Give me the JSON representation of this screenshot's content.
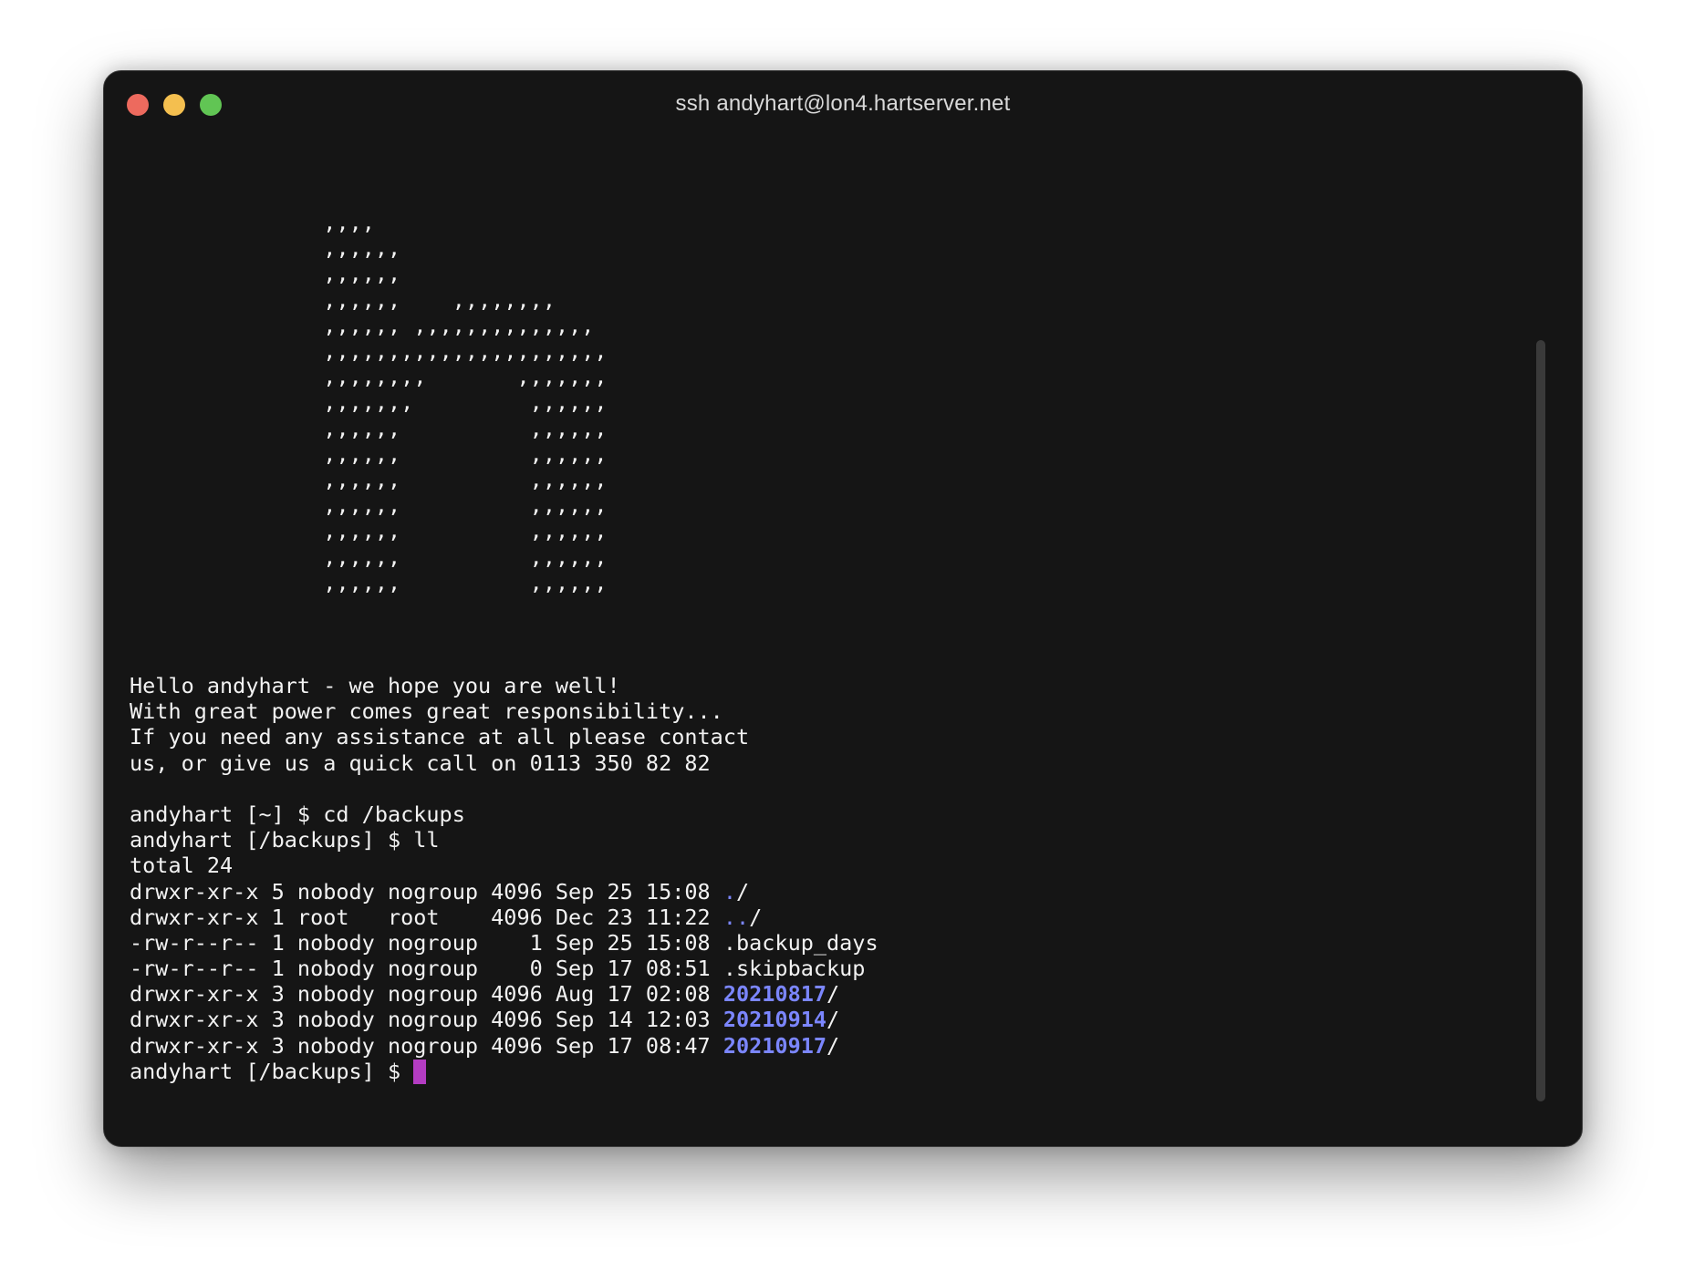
{
  "window": {
    "title": "ssh andyhart@lon4.hartserver.net",
    "traffic_lights": {
      "close": "#ed6a5e",
      "minimize": "#f4bf4f",
      "zoom": "#61c554"
    }
  },
  "terminal": {
    "ascii_art": "  ,,,,\n  ,,,,,,\n  ,,,,,,\n  ,,,,,,    ,,,,,,,,\n  ,,,,,, ,,,,,,,,,,,,,,\n  ,,,,,,,,,,,,,,,,,,,,,,\n  ,,,,,,,,       ,,,,,,,\n  ,,,,,,,         ,,,,,,\n  ,,,,,,          ,,,,,,\n  ,,,,,,          ,,,,,,\n  ,,,,,,          ,,,,,,\n  ,,,,,,          ,,,,,,\n  ,,,,,,          ,,,,,,\n  ,,,,,,          ,,,,,,\n  ,,,,,,          ,,,,,,",
    "motd": [
      "Hello andyhart - we hope you are well!",
      "With great power comes great responsibility...",
      "If you need any assistance at all please contact",
      "us, or give us a quick call on 0113 350 82 82"
    ],
    "commands": [
      "andyhart [~] $ cd /backups",
      "andyhart [/backups] $ ll"
    ],
    "total": "total 24",
    "listing": [
      {
        "meta": "drwxr-xr-x 5 nobody nogroup 4096 Sep 25 15:08 ",
        "dot": ".",
        "name": "",
        "suffix": "/"
      },
      {
        "meta": "drwxr-xr-x 1 root   root    4096 Dec 23 11:22 ",
        "dot": "..",
        "name": "",
        "suffix": "/"
      },
      {
        "meta": "-rw-r--r-- 1 nobody nogroup    1 Sep 25 15:08 ",
        "dot": "",
        "name": ".backup_days",
        "suffix": ""
      },
      {
        "meta": "-rw-r--r-- 1 nobody nogroup    0 Sep 17 08:51 ",
        "dot": "",
        "name": ".skipbackup",
        "suffix": ""
      },
      {
        "meta": "drwxr-xr-x 3 nobody nogroup 4096 Aug 17 02:08 ",
        "dot": "",
        "dir": "20210817",
        "suffix": "/"
      },
      {
        "meta": "drwxr-xr-x 3 nobody nogroup 4096 Sep 14 12:03 ",
        "dot": "",
        "dir": "20210914",
        "suffix": "/"
      },
      {
        "meta": "drwxr-xr-x 3 nobody nogroup 4096 Sep 17 08:47 ",
        "dot": "",
        "dir": "20210917",
        "suffix": "/"
      }
    ],
    "prompt": "andyhart [/backups] $ ",
    "colors": {
      "background": "#151515",
      "text": "#f2f2f2",
      "directory": "#7b86ff",
      "cursor": "#b33cc2"
    }
  }
}
